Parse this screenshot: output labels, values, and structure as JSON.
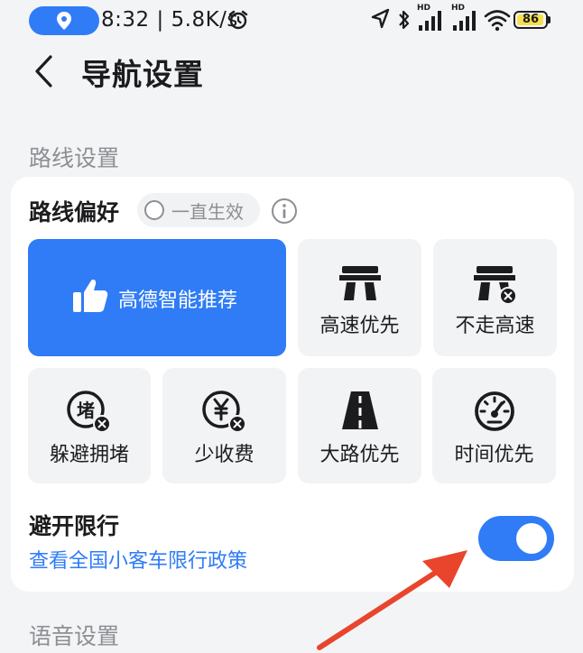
{
  "status_bar": {
    "time_speed": "8:32 | 5.8K/s",
    "battery": "86",
    "hd_label": "HD"
  },
  "header": {
    "title": "导航设置"
  },
  "route_section": {
    "title": "路线设置",
    "preference_title": "路线偏好",
    "always_label": "一直生效",
    "options": [
      {
        "label": "高德智能推荐",
        "icon": "thumbs-up-icon",
        "selected": true
      },
      {
        "label": "高速优先",
        "icon": "highway-icon"
      },
      {
        "label": "不走高速",
        "icon": "no-highway-icon"
      },
      {
        "label": "躲避拥堵",
        "icon": "avoid-congestion-icon"
      },
      {
        "label": "少收费",
        "icon": "less-toll-icon"
      },
      {
        "label": "大路优先",
        "icon": "main-road-icon"
      },
      {
        "label": "时间优先",
        "icon": "speedometer-icon"
      }
    ],
    "avoid_restriction": {
      "title": "避开限行",
      "link": "查看全国小客车限行政策",
      "enabled": true
    }
  },
  "voice_section": {
    "title": "语音设置"
  },
  "colors": {
    "accent": "#2f7cf6",
    "annotation_arrow": "#e8452c"
  }
}
